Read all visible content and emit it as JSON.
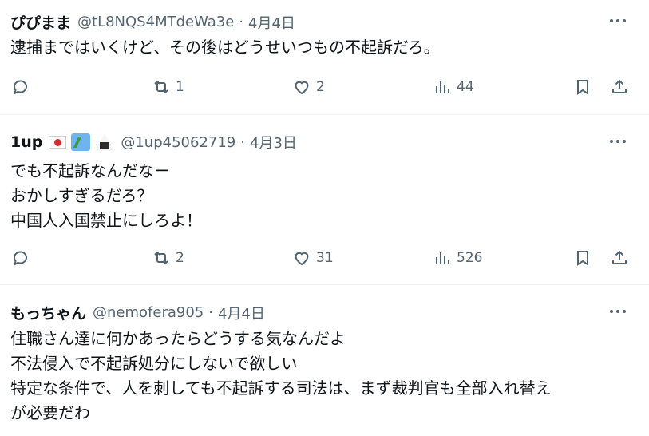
{
  "tweets": [
    {
      "name": "ぴぴまま",
      "handle": "@tL8NQS4MTdeWa3e",
      "sep": "·",
      "date": "4月4日",
      "lines": [
        "逮捕まではいくけど、その後はどうせいつもの不起訴だろ。"
      ],
      "stats": {
        "reposts": "1",
        "likes": "2",
        "views": "44"
      }
    },
    {
      "name": "1up",
      "handle": "@1up45062719",
      "sep": "·",
      "date": "4月3日",
      "lines": [
        "でも不起訴なんだなー",
        "おかしすぎるだろ？",
        "中国人入国禁止にしろよ！"
      ],
      "stats": {
        "reposts": "2",
        "likes": "31",
        "views": "526"
      }
    },
    {
      "name": "もっちゃん",
      "handle": "@nemofera905",
      "sep": "·",
      "date": "4月4日",
      "lines": [
        "住職さん達に何かあったらどうする気なんだよ",
        "不法侵入で不起訴処分にしないで欲しい",
        "特定な条件で、人を刺しても不起訴する司法は、まず裁判官も全部入れ替え",
        "が必要だわ"
      ]
    }
  ],
  "icons": {
    "reply": "reply-icon",
    "repost": "repost-icon",
    "like": "heart-icon",
    "views": "views-icon",
    "bookmark": "bookmark-icon",
    "share": "share-icon",
    "more": "more-icon"
  }
}
